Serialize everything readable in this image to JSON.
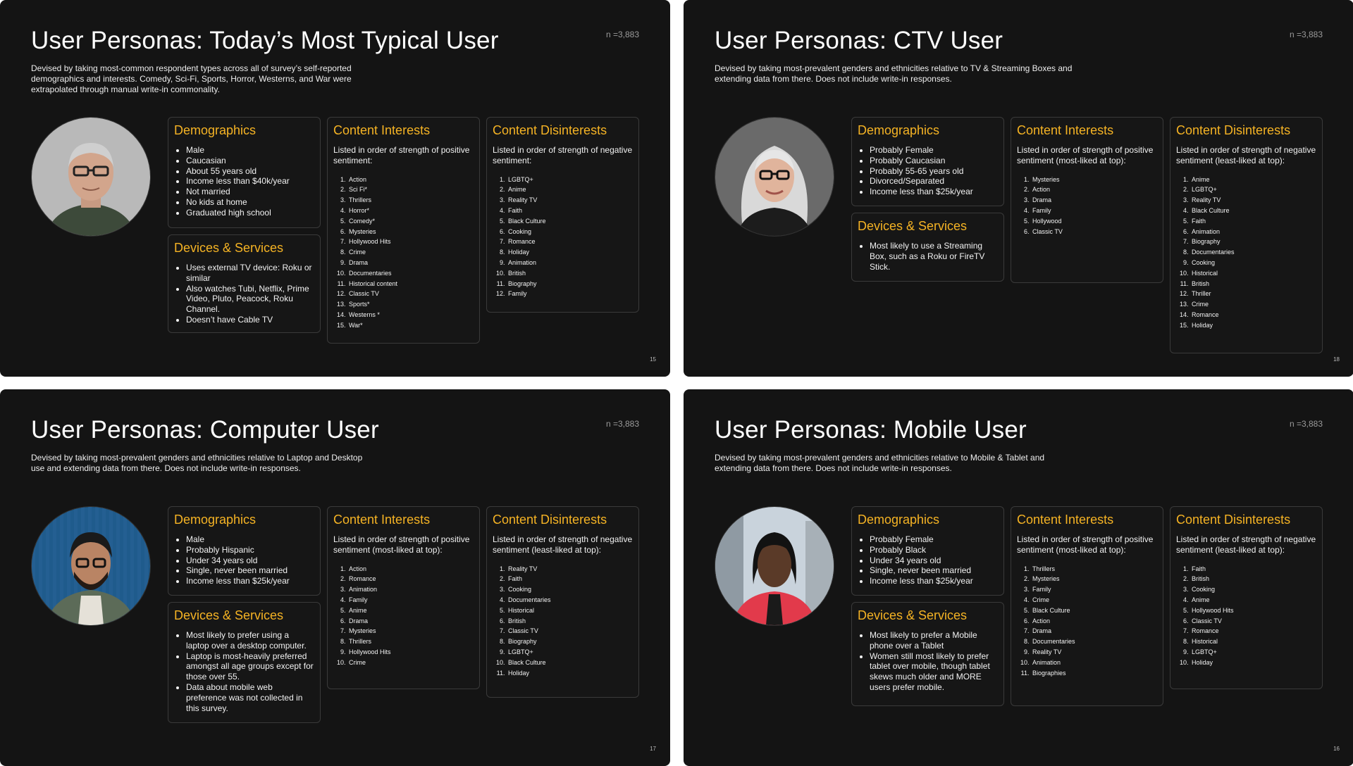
{
  "colors": {
    "accent": "#f5b324",
    "slide_bg": "#141414",
    "box_border": "#3a3a3a"
  },
  "slides": [
    {
      "title": "User Personas: Today’s Most Typical User",
      "n_label": "n =3,883",
      "description": "Devised by taking most-common respondent types across all of survey’s self-reported demographics and interests. Comedy, Sci-Fi, Sports, Horror, Westerns, and War were extrapolated through manual write-in commonality.",
      "page_number": "15",
      "demographics": {
        "heading": "Demographics",
        "items": [
          "Male",
          "Caucasian",
          "About 55 years old",
          "Income less than $40k/year",
          "Not married",
          "No kids at home",
          "Graduated high school"
        ]
      },
      "devices": {
        "heading": "Devices & Services",
        "items": [
          "Uses external TV device: Roku or similar",
          "Also watches Tubi, Netflix, Prime Video, Pluto, Peacock, Roku Channel.",
          "Doesn’t have Cable TV"
        ]
      },
      "interests": {
        "heading": "Content Interests",
        "intro": "Listed in order of strength of positive sentiment:",
        "items": [
          "Action",
          "Sci Fi*",
          "Thrillers",
          "Horror*",
          "Comedy*",
          "Mysteries",
          "Hollywood Hits",
          "Crime",
          "Drama",
          "Documentaries",
          "Historical content",
          "Classic TV",
          "Sports*",
          "Westerns *",
          "War*"
        ]
      },
      "disinterests": {
        "heading": "Content Disinterests",
        "intro": "Listed in order of strength of negative sentiment:",
        "items": [
          "LGBTQ+",
          "Anime",
          "Reality TV",
          "Faith",
          "Black Culture",
          "Cooking",
          "Romance",
          "Holiday",
          "Animation",
          "British",
          "Biography",
          "Family"
        ]
      }
    },
    {
      "title": "User Personas: CTV User",
      "n_label": "n =3,883",
      "description": "Devised by taking most-prevalent genders and ethnicities relative to TV & Streaming Boxes and extending data from there. Does not include write-in responses.",
      "page_number": "18",
      "demographics": {
        "heading": "Demographics",
        "items": [
          "Probably Female",
          "Probably Caucasian",
          "Probably 55-65 years old",
          "Divorced/Separated",
          "Income less than $25k/year"
        ]
      },
      "devices": {
        "heading": "Devices & Services",
        "items": [
          "Most likely to use a Streaming Box, such as a Roku or FireTV Stick."
        ]
      },
      "interests": {
        "heading": "Content Interests",
        "intro": "Listed in order of strength of positive sentiment (most-liked at top):",
        "items": [
          "Mysteries",
          "Action",
          "Drama",
          "Family",
          "Hollywood",
          "Classic TV"
        ]
      },
      "disinterests": {
        "heading": "Content Disinterests",
        "intro": "Listed in order of strength of negative sentiment (least-liked at top):",
        "items": [
          "Anime",
          "LGBTQ+",
          "Reality TV",
          "Black Culture",
          "Faith",
          "Animation",
          "Biography",
          "Documentaries",
          "Cooking",
          "Historical",
          "British",
          "Thriller",
          "Crime",
          "Romance",
          "Holiday"
        ]
      }
    },
    {
      "title": "User Personas: Computer User",
      "n_label": "n =3,883",
      "description": "Devised by taking most-prevalent genders and ethnicities relative to Laptop and Desktop use and extending data from there. Does not include write-in responses.",
      "page_number": "17",
      "demographics": {
        "heading": "Demographics",
        "items": [
          "Male",
          "Probably Hispanic",
          "Under 34 years old",
          "Single, never been married",
          "Income less than $25k/year"
        ]
      },
      "devices": {
        "heading": "Devices & Services",
        "items": [
          "Most likely to prefer using a laptop over a desktop computer.",
          "Laptop is most-heavily preferred amongst all age groups except for those over 55.",
          "Data about mobile web preference was not collected in this survey."
        ]
      },
      "interests": {
        "heading": "Content Interests",
        "intro": "Listed in order of strength of positive sentiment (most-liked at top):",
        "items": [
          "Action",
          "Romance",
          "Animation",
          "Family",
          "Anime",
          "Drama",
          "Mysteries",
          "Thrillers",
          "Hollywood Hits",
          "Crime"
        ]
      },
      "disinterests": {
        "heading": "Content Disinterests",
        "intro": "Listed in order of strength of negative sentiment (least-liked at top):",
        "items": [
          "Reality TV",
          "Faith",
          "Cooking",
          "Documentaries",
          "Historical",
          "British",
          "Classic TV",
          "Biography",
          "LGBTQ+",
          "Black Culture",
          "Holiday"
        ]
      }
    },
    {
      "title": "User Personas: Mobile User",
      "n_label": "n =3,883",
      "description": "Devised by taking most-prevalent genders and ethnicities relative to Mobile & Tablet and extending data from there. Does not include write-in responses.",
      "page_number": "16",
      "demographics": {
        "heading": "Demographics",
        "items": [
          "Probably Female",
          "Probably Black",
          "Under 34 years old",
          "Single, never been married",
          "Income less than $25k/year"
        ]
      },
      "devices": {
        "heading": "Devices & Services",
        "items": [
          "Most likely to prefer a Mobile phone over a Tablet",
          "Women still most likely to prefer tablet over mobile, though tablet skews much older and MORE users prefer mobile."
        ]
      },
      "interests": {
        "heading": "Content Interests",
        "intro": "Listed in order of strength of positive sentiment (most-liked at top):",
        "items": [
          "Thrillers",
          "Mysteries",
          "Family",
          "Crime",
          "Black Culture",
          "Action",
          "Drama",
          "Documentaries",
          "Reality TV",
          "Animation",
          "Biographies"
        ]
      },
      "disinterests": {
        "heading": "Content Disinterests",
        "intro": "Listed in order of strength of negative sentiment (least-liked at top):",
        "items": [
          "Faith",
          "British",
          "Cooking",
          "Anime",
          "Hollywood Hits",
          "Classic TV",
          "Romance",
          "Historical",
          "LGBTQ+",
          "Holiday"
        ]
      }
    }
  ]
}
